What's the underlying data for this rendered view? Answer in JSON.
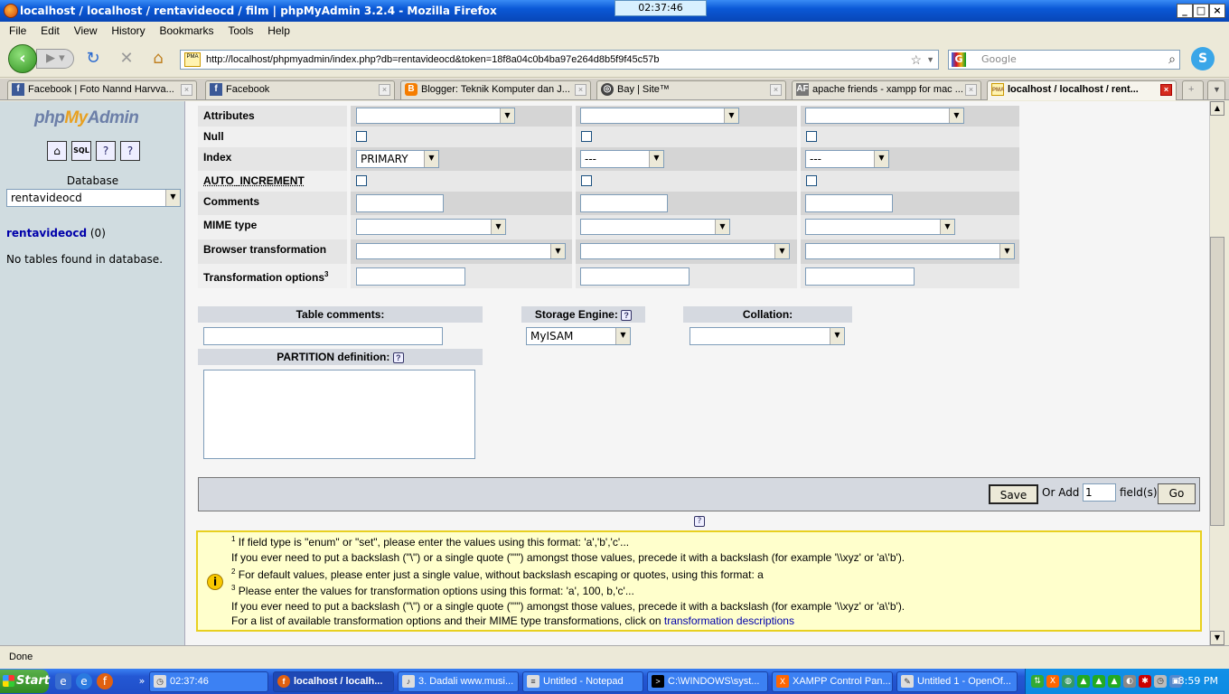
{
  "window": {
    "title": "localhost / localhost / rentavideocd / film | phpMyAdmin 3.2.4 - Mozilla Firefox",
    "clock_overlay": "02:37:46",
    "minimize": "_",
    "maximize": "□",
    "close": "×"
  },
  "menu": [
    "File",
    "Edit",
    "View",
    "History",
    "Bookmarks",
    "Tools",
    "Help"
  ],
  "nav": {
    "url": "http://localhost/phpmyadmin/index.php?db=rentavideocd&token=18f8a04c0b4ba97e264d8b5f9f45c57b",
    "search_placeholder": "Google"
  },
  "tabs": [
    {
      "label": "Facebook | Foto Nannd Harvva...",
      "icon": "facebook-icon"
    },
    {
      "label": "Facebook",
      "icon": "facebook-icon"
    },
    {
      "label": "Blogger: Teknik Komputer dan J...",
      "icon": "blogger-icon"
    },
    {
      "label": "Bay | Site™",
      "icon": "site-icon"
    },
    {
      "label": "apache friends - xampp for mac ...",
      "icon": "apache-friends-icon"
    },
    {
      "label": "localhost / localhost / rent...",
      "icon": "pma-icon",
      "active": true
    }
  ],
  "sidebar": {
    "logo_php": "php",
    "logo_my": "My",
    "logo_admin": "Admin",
    "database_label": "Database",
    "database_selected": "rentavideocd",
    "db_link": "rentavideocd",
    "db_count": "(0)",
    "no_tables": "No tables found in database."
  },
  "form": {
    "rows": {
      "attributes": "Attributes",
      "null": "Null",
      "index": "Index",
      "auto_increment": "AUTO_INCREMENT",
      "comments": "Comments",
      "mime": "MIME type",
      "browser": "Browser transformation",
      "transformation": "Transformation options"
    },
    "index_values": [
      "PRIMARY",
      "---",
      "---"
    ],
    "table_comments": "Table comments:",
    "storage_engine": "Storage Engine:",
    "storage_engine_value": "MyISAM",
    "collation": "Collation:",
    "partition": "PARTITION definition:",
    "save": "Save",
    "or_add": "Or Add",
    "add_count": "1",
    "fields": "field(s)",
    "go": "Go"
  },
  "notice": {
    "l1": " If field type is \"enum\" or \"set\", please enter the values using this format: 'a','b','c'...",
    "l2": "If you ever need to put a backslash (\"\\\") or a single quote (\"'\") amongst those values, precede it with a backslash (for example '\\\\xyz' or 'a\\'b').",
    "l3": " For default values, please enter just a single value, without backslash escaping or quotes, using this format: a",
    "l4": " Please enter the values for transformation options using this format: 'a', 100, b,'c'...",
    "l5": "If you ever need to put a backslash (\"\\\") or a single quote (\"'\") amongst those values, precede it with a backslash (for example '\\\\xyz' or 'a\\'b').",
    "l6": "For a list of available transformation options and their MIME type transformations, click on ",
    "link": "transformation descriptions"
  },
  "status": "Done",
  "taskbar": {
    "start": "Start",
    "tasks": [
      "02:37:46",
      "localhost / localh...",
      "3. Dadali www.musi...",
      "Untitled - Notepad",
      "C:\\WINDOWS\\syst...",
      "XAMPP Control Pan...",
      "Untitled 1 - OpenOf..."
    ],
    "time": "8:59 PM"
  }
}
